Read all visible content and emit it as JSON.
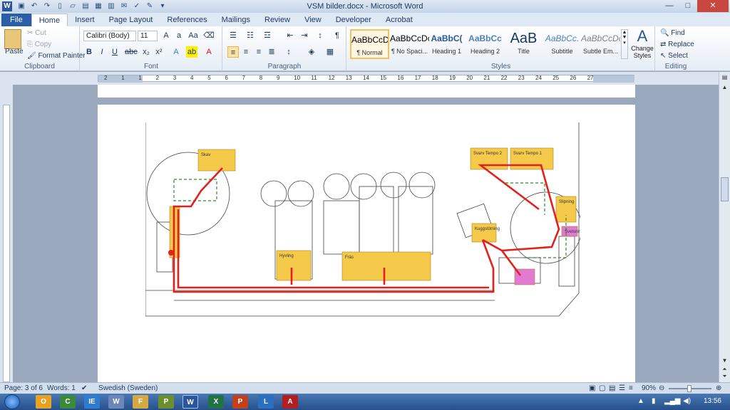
{
  "window": {
    "title": "VSM bilder.docx - Microsoft Word",
    "app_icon": "W",
    "qat_icons": [
      "save-icon",
      "undo-icon",
      "redo-icon",
      "new-icon",
      "open-icon",
      "save-as-icon",
      "print-preview-icon",
      "quick-print-icon",
      "email-icon",
      "spelling-icon",
      "format-painter-icon",
      "customize-icon"
    ],
    "min": "—",
    "max": "□",
    "close": "✕"
  },
  "tabs": [
    "File",
    "Home",
    "Insert",
    "Page Layout",
    "References",
    "Mailings",
    "Review",
    "View",
    "Developer",
    "Acrobat"
  ],
  "active_tab": "Home",
  "clipboard": {
    "label": "Clipboard",
    "paste": "Paste",
    "cut": "Cut",
    "copy": "Copy",
    "format_painter": "Format Painter"
  },
  "font": {
    "label": "Font",
    "family": "Calibri (Body)",
    "size": "11"
  },
  "paragraph": {
    "label": "Paragraph"
  },
  "styles": {
    "label": "Styles",
    "items": [
      {
        "preview": "AaBbCcDc",
        "name": "¶ Normal"
      },
      {
        "preview": "AaBbCcDc",
        "name": "¶ No Spaci..."
      },
      {
        "preview": "AaBbC(",
        "name": "Heading 1"
      },
      {
        "preview": "AaBbCc",
        "name": "Heading 2"
      },
      {
        "preview": "AaB",
        "name": "Title"
      },
      {
        "preview": "AaBbCc.",
        "name": "Subtitle"
      },
      {
        "preview": "AaBbCcDc",
        "name": "Subtle Em..."
      }
    ],
    "change_styles": "Change Styles"
  },
  "editing": {
    "label": "Editing",
    "find": "Find",
    "replace": "Replace",
    "select": "Select"
  },
  "ruler": {
    "numbers": [
      "2",
      "1",
      "1",
      "2",
      "3",
      "4",
      "5",
      "6",
      "7",
      "8",
      "9",
      "10",
      "11",
      "12",
      "13",
      "14",
      "15",
      "16",
      "17",
      "18",
      "19",
      "20",
      "21",
      "22",
      "23",
      "24",
      "25",
      "26",
      "27"
    ]
  },
  "plan": {
    "labels": [
      "Skav",
      "Svarv Tempo 2",
      "Svarv Tempo 1",
      "Hyvling",
      "Fräs",
      "Slipning",
      "Kuggstötning",
      "Svetsning"
    ],
    "colors": {
      "station": "#f5c94a",
      "flow": "#e4201c",
      "pink": "#e37ad2",
      "green": "#2d8a2d"
    }
  },
  "status": {
    "page": "Page: 3 of 6",
    "words": "Words: 1",
    "language": "Swedish (Sweden)",
    "zoom": "90%"
  },
  "taskbar": {
    "apps": [
      "O",
      "C",
      "IE",
      "W",
      "F",
      "P",
      "W",
      "X",
      "P",
      "L",
      "A"
    ],
    "clock": "13:56"
  }
}
